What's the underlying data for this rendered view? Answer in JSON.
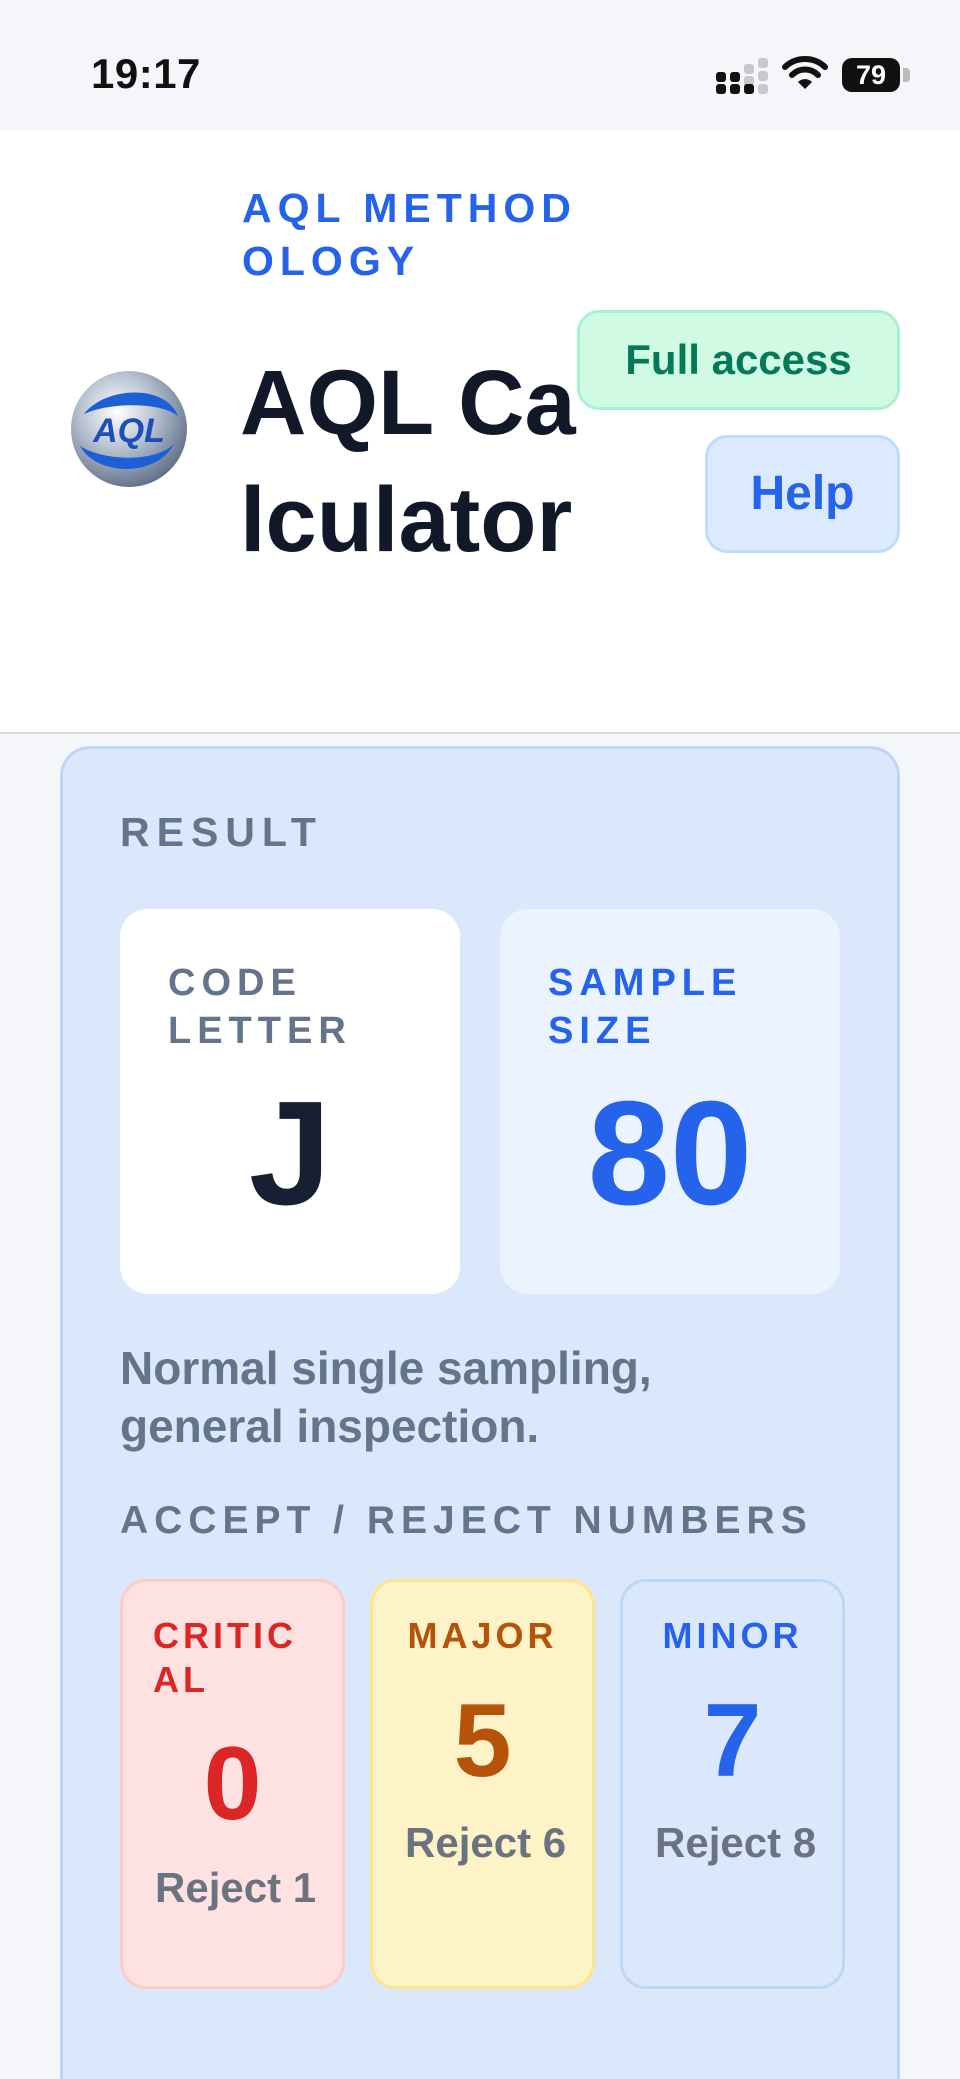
{
  "status_bar": {
    "time": "19:17",
    "battery": "79",
    "signal_icon": "cellular-signal-icon",
    "wifi_icon": "wifi-icon"
  },
  "header": {
    "kicker": "AQL METHODOLOGY",
    "title": "AQL Calculator",
    "logo_text": "AQL",
    "access_badge": "Full access",
    "help_button": "Help"
  },
  "result": {
    "section_label": "RESULT",
    "code_letter": {
      "label": "CODE LETTER",
      "value": "J"
    },
    "sample_size": {
      "label": "SAMPLE SIZE",
      "value": "80"
    },
    "description": "Normal single sampling, general inspection.",
    "accept_reject_label": "ACCEPT / REJECT NUMBERS",
    "categories": [
      {
        "name": "CRITICAL",
        "accept": "0",
        "reject": "Reject 1"
      },
      {
        "name": "MAJOR",
        "accept": "5",
        "reject": "Reject 6"
      },
      {
        "name": "MINOR",
        "accept": "7",
        "reject": "Reject 8"
      }
    ]
  },
  "colors": {
    "accent": "#2563eb",
    "critical": "#dc2626",
    "major": "#b45309",
    "success": "#047857"
  }
}
